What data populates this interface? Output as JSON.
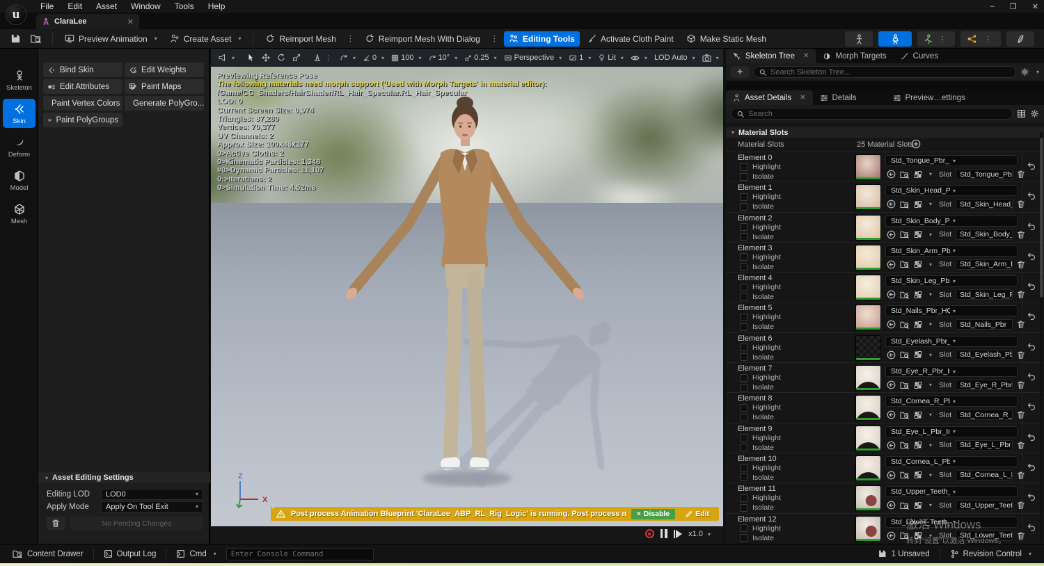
{
  "menus": [
    "File",
    "Edit",
    "Asset",
    "Window",
    "Tools",
    "Help"
  ],
  "doc_tab": {
    "title": "ClaraLee"
  },
  "window_controls": {
    "minimize": "–",
    "maximize": "❐",
    "close": "✕"
  },
  "main_toolbar": {
    "preview_animation": "Preview Animation",
    "create_asset": "Create Asset",
    "reimport_mesh": "Reimport Mesh",
    "reimport_mesh_dialog": "Reimport Mesh With Dialog",
    "editing_tools": "Editing Tools",
    "activate_cloth_paint": "Activate Cloth Paint",
    "make_static_mesh": "Make Static Mesh"
  },
  "left_sidebar": {
    "items": [
      {
        "label": "Skeleton",
        "active": false
      },
      {
        "label": "Skin",
        "active": true
      },
      {
        "label": "Deform",
        "active": false
      },
      {
        "label": "Model",
        "active": false
      },
      {
        "label": "Mesh",
        "active": false
      }
    ]
  },
  "tool_buttons": [
    "Bind Skin",
    "Edit Weights",
    "Edit Attributes",
    "Paint Maps",
    "Paint Vertex Colors",
    "Generate PolyGro...",
    "Paint PolyGroups"
  ],
  "asset_editing": {
    "header": "Asset Editing Settings",
    "editing_lod_label": "Editing LOD",
    "editing_lod_value": "LOD0",
    "apply_mode_label": "Apply Mode",
    "apply_mode_value": "Apply On Tool Exit",
    "pending_label": "No Pending Changes"
  },
  "viewport_toolbar": {
    "snap_angle": "0",
    "grid_size": "100",
    "rotation_snap": "10°",
    "scale_snap": "0.25",
    "projection": "Perspective",
    "screen_percent": "1",
    "lit_mode": "Lit",
    "lod": "LOD Auto"
  },
  "viewport_stats": [
    {
      "text": "Previewing Reference Pose",
      "warn": false
    },
    {
      "text": "The following materials need morph support ('Used with Morph Targets' in material editor):",
      "warn": true
    },
    {
      "text": "/Game/CC_Shaders/HairShader/RL_Hair_Specular.RL_Hair_Specular",
      "warn": false
    },
    {
      "text": "LOD: 0",
      "warn": false
    },
    {
      "text": "Current Screen Size: 0,974",
      "warn": false
    },
    {
      "text": "Triangles: 87,280",
      "warn": false
    },
    {
      "text": "Vertices: 70,377",
      "warn": false
    },
    {
      "text": "UV Channels: 2",
      "warn": false
    },
    {
      "text": "Approx Size: 100x46x177",
      "warn": false
    },
    {
      "text": "0>Active Cloths: 2",
      "warn": false
    },
    {
      "text": "0>Kinematic Particles: 1,348",
      "warn": false
    },
    {
      "text": "#0>Dynamic Particles: 11,107",
      "warn": false
    },
    {
      "text": "0:>Iterations: 2",
      "warn": false
    },
    {
      "text": "0>Simulation Time: 4.52ms",
      "warn": false
    }
  ],
  "warning_banner": {
    "message": "Post process Animation Blueprint 'ClaraLee_ABP_RL_Rig_Logic' is running. Post process modifes curves.",
    "disable_label": "Disable",
    "edit_label": "Edit"
  },
  "playback": {
    "speed": "x1.0"
  },
  "axis_gizmo": {
    "z": "Z",
    "x": "X"
  },
  "right_panel": {
    "tabs_top": [
      {
        "label": "Skeleton Tree",
        "active": true
      },
      {
        "label": "Morph Targets",
        "active": false
      },
      {
        "label": "Curves",
        "active": false
      }
    ],
    "search_skeleton_placeholder": "Search Skeleton Tree...",
    "tabs_details": [
      {
        "label": "Asset Details",
        "active": true
      },
      {
        "label": "Details",
        "active": false
      },
      {
        "label": "Preview…ettings",
        "active": false
      }
    ],
    "search_placeholder": "Search",
    "material_slots": {
      "header": "Material Slots",
      "column_label": "Material Slots",
      "count_label": "25 Material Slots",
      "highlight_label": "Highlight",
      "isolate_label": "Isolate",
      "slot_label": "Slot",
      "elements": [
        {
          "name": "Element 0",
          "inst": "Std_Tongue_Pbr_LWHQ_Inst",
          "slot": "Std_Tongue_Pbr",
          "thumb": {
            "kind": "sphere",
            "c1": "#e9d5cb",
            "c2": "#a97e72"
          }
        },
        {
          "name": "Element 1",
          "inst": "Std_Skin_Head_Pbr_HQ_Inst",
          "slot": "Std_Skin_Head_Pbr",
          "thumb": {
            "kind": "sphere",
            "c1": "#f3e9dc",
            "c2": "#d9bda4"
          }
        },
        {
          "name": "Element 2",
          "inst": "Std_Skin_Body_Pbr_HQ_Inst",
          "slot": "Std_Skin_Body_Pbr",
          "thumb": {
            "kind": "sphere",
            "c1": "#f4ecdd",
            "c2": "#e0c6aa"
          }
        },
        {
          "name": "Element 3",
          "inst": "Std_Skin_Arm_Pbr_HQ_Inst",
          "slot": "Std_Skin_Arm_Pbr",
          "thumb": {
            "kind": "sphere",
            "c1": "#f4ead8",
            "c2": "#e3ccb0"
          }
        },
        {
          "name": "Element 4",
          "inst": "Std_Skin_Leg_Pbr_HQ_Inst",
          "slot": "Std_Skin_Leg_Pbr",
          "thumb": {
            "kind": "sphere",
            "c1": "#f5eede",
            "c2": "#e5d0b6"
          }
        },
        {
          "name": "Element 5",
          "inst": "Std_Nails_Pbr_HQ_Inst",
          "slot": "Std_Nails_Pbr",
          "thumb": {
            "kind": "sphere",
            "c1": "#f0dfd2",
            "c2": "#c99f92"
          }
        },
        {
          "name": "Element 6",
          "inst": "Std_Eyelash_Pbr_LWHQ_Inst",
          "slot": "Std_Eyelash_Pbr",
          "thumb": {
            "kind": "checker",
            "c1": "#141414",
            "c2": "#232323"
          }
        },
        {
          "name": "Element 7",
          "inst": "Std_Eye_R_Pbr_Inst",
          "slot": "Std_Eye_R_Pbr",
          "thumb": {
            "kind": "eye",
            "c1": "#f7f2ea",
            "c2": "#d9d0c4"
          }
        },
        {
          "name": "Element 8",
          "inst": "Std_Cornea_R_Pbr_LWHQ_Inst",
          "slot": "Std_Cornea_R_Pbr",
          "thumb": {
            "kind": "eye",
            "c1": "#f6efe6",
            "c2": "#d8cec2"
          }
        },
        {
          "name": "Element 9",
          "inst": "Std_Eye_L_Pbr_Inst",
          "slot": "Std_Eye_L_Pbr",
          "thumb": {
            "kind": "eye",
            "c1": "#f7f2ea",
            "c2": "#d9d0c4"
          }
        },
        {
          "name": "Element 10",
          "inst": "Std_Cornea_L_Pbr_LWHQ_Inst",
          "slot": "Std_Cornea_L_Pbr",
          "thumb": {
            "kind": "eye",
            "c1": "#f6efe6",
            "c2": "#d8cec2"
          }
        },
        {
          "name": "Element 11",
          "inst": "Std_Upper_Teeth_Pbr_LWHQ_Inst",
          "slot": "Std_Upper_Teeth_Pb",
          "thumb": {
            "kind": "teeth",
            "c1": "#f1ece4",
            "c2": "#c2b8ac"
          }
        },
        {
          "name": "Element 12",
          "inst": "Std_Lower_Teeth_Pbr_LWHQ_Inst",
          "slot": "Std_Lower_Teeth_Pb",
          "thumb": {
            "kind": "teeth",
            "c1": "#f1ece4",
            "c2": "#c2b8ac"
          }
        }
      ]
    }
  },
  "status_bar": {
    "content_drawer": "Content Drawer",
    "output_log": "Output Log",
    "cmd": "Cmd",
    "console_placeholder": "Enter Console Command",
    "unsaved": "1 Unsaved",
    "revision_control": "Revision Control"
  },
  "watermark": {
    "line1": "激活 Windows",
    "line2": "转到“设置”以激活 Windows。"
  },
  "colors": {
    "accent_blue": "#0070e0",
    "warning_amber": "#d6a511",
    "disable_green": "#43a047",
    "stats_warning_yellow": "#e5d24b",
    "thumb_ready_green": "#2f9e2f"
  }
}
